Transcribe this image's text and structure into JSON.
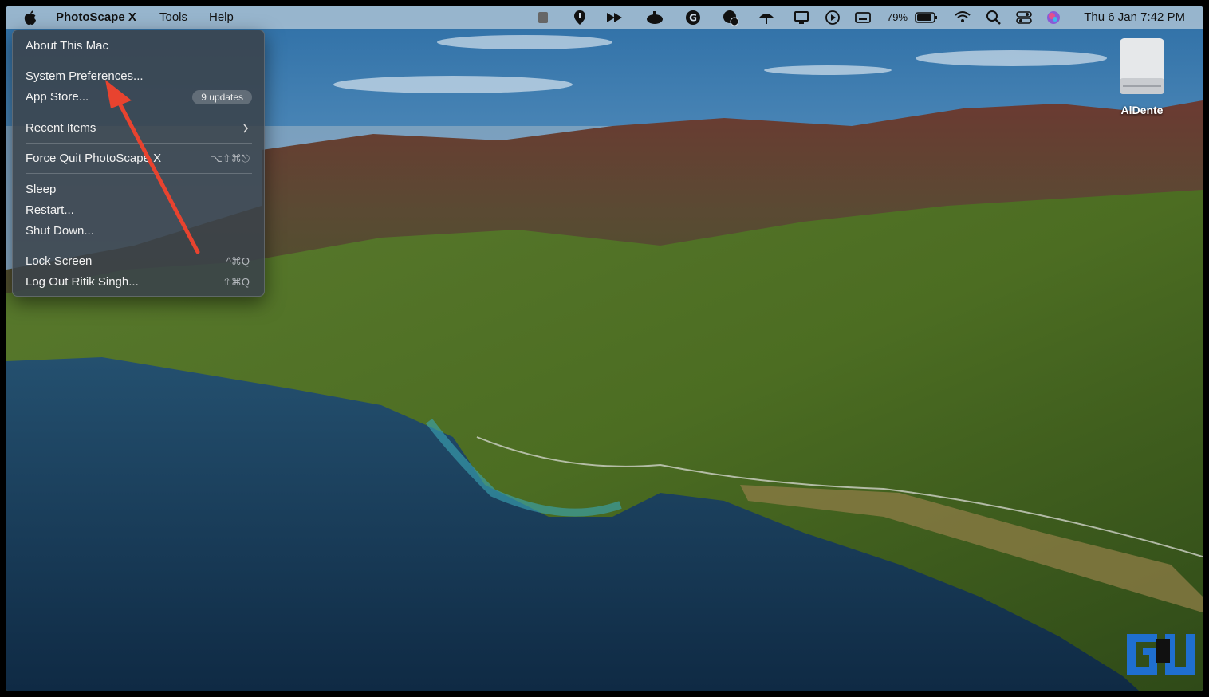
{
  "menubar": {
    "app_name": "PhotoScape X",
    "menus": [
      "Tools",
      "Help"
    ],
    "battery_percent": "79%",
    "clock": "Thu 6 Jan  7:42 PM",
    "status_icons": [
      "script-icon",
      "location-pin-icon",
      "fast-forward-icon",
      "cloud-mac-icon",
      "grammarly-icon",
      "badge-app-icon",
      "umbrella-icon",
      "display-icon",
      "play-circle-icon",
      "keyboard-icon",
      "battery-icon",
      "wifi-icon",
      "search-icon",
      "control-center-icon",
      "siri-icon"
    ]
  },
  "apple_menu": {
    "items": [
      {
        "label": "About This Mac"
      },
      {
        "label": "System Preferences..."
      },
      {
        "label": "App Store...",
        "badge": "9 updates"
      },
      {
        "label": "Recent Items"
      },
      {
        "label": "Force Quit PhotoScape X",
        "shortcut": "⌥⇧⌘⎋"
      },
      {
        "label": "Sleep"
      },
      {
        "label": "Restart..."
      },
      {
        "label": "Shut Down..."
      },
      {
        "label": "Lock Screen",
        "shortcut": "^⌘Q"
      },
      {
        "label": "Log Out Ritik Singh...",
        "shortcut": "⇧⌘Q"
      }
    ]
  },
  "desktop": {
    "drive_label": "AlDente"
  },
  "colors": {
    "annotation_arrow": "#e8432f",
    "watermark_blue": "#1f6fd0"
  }
}
